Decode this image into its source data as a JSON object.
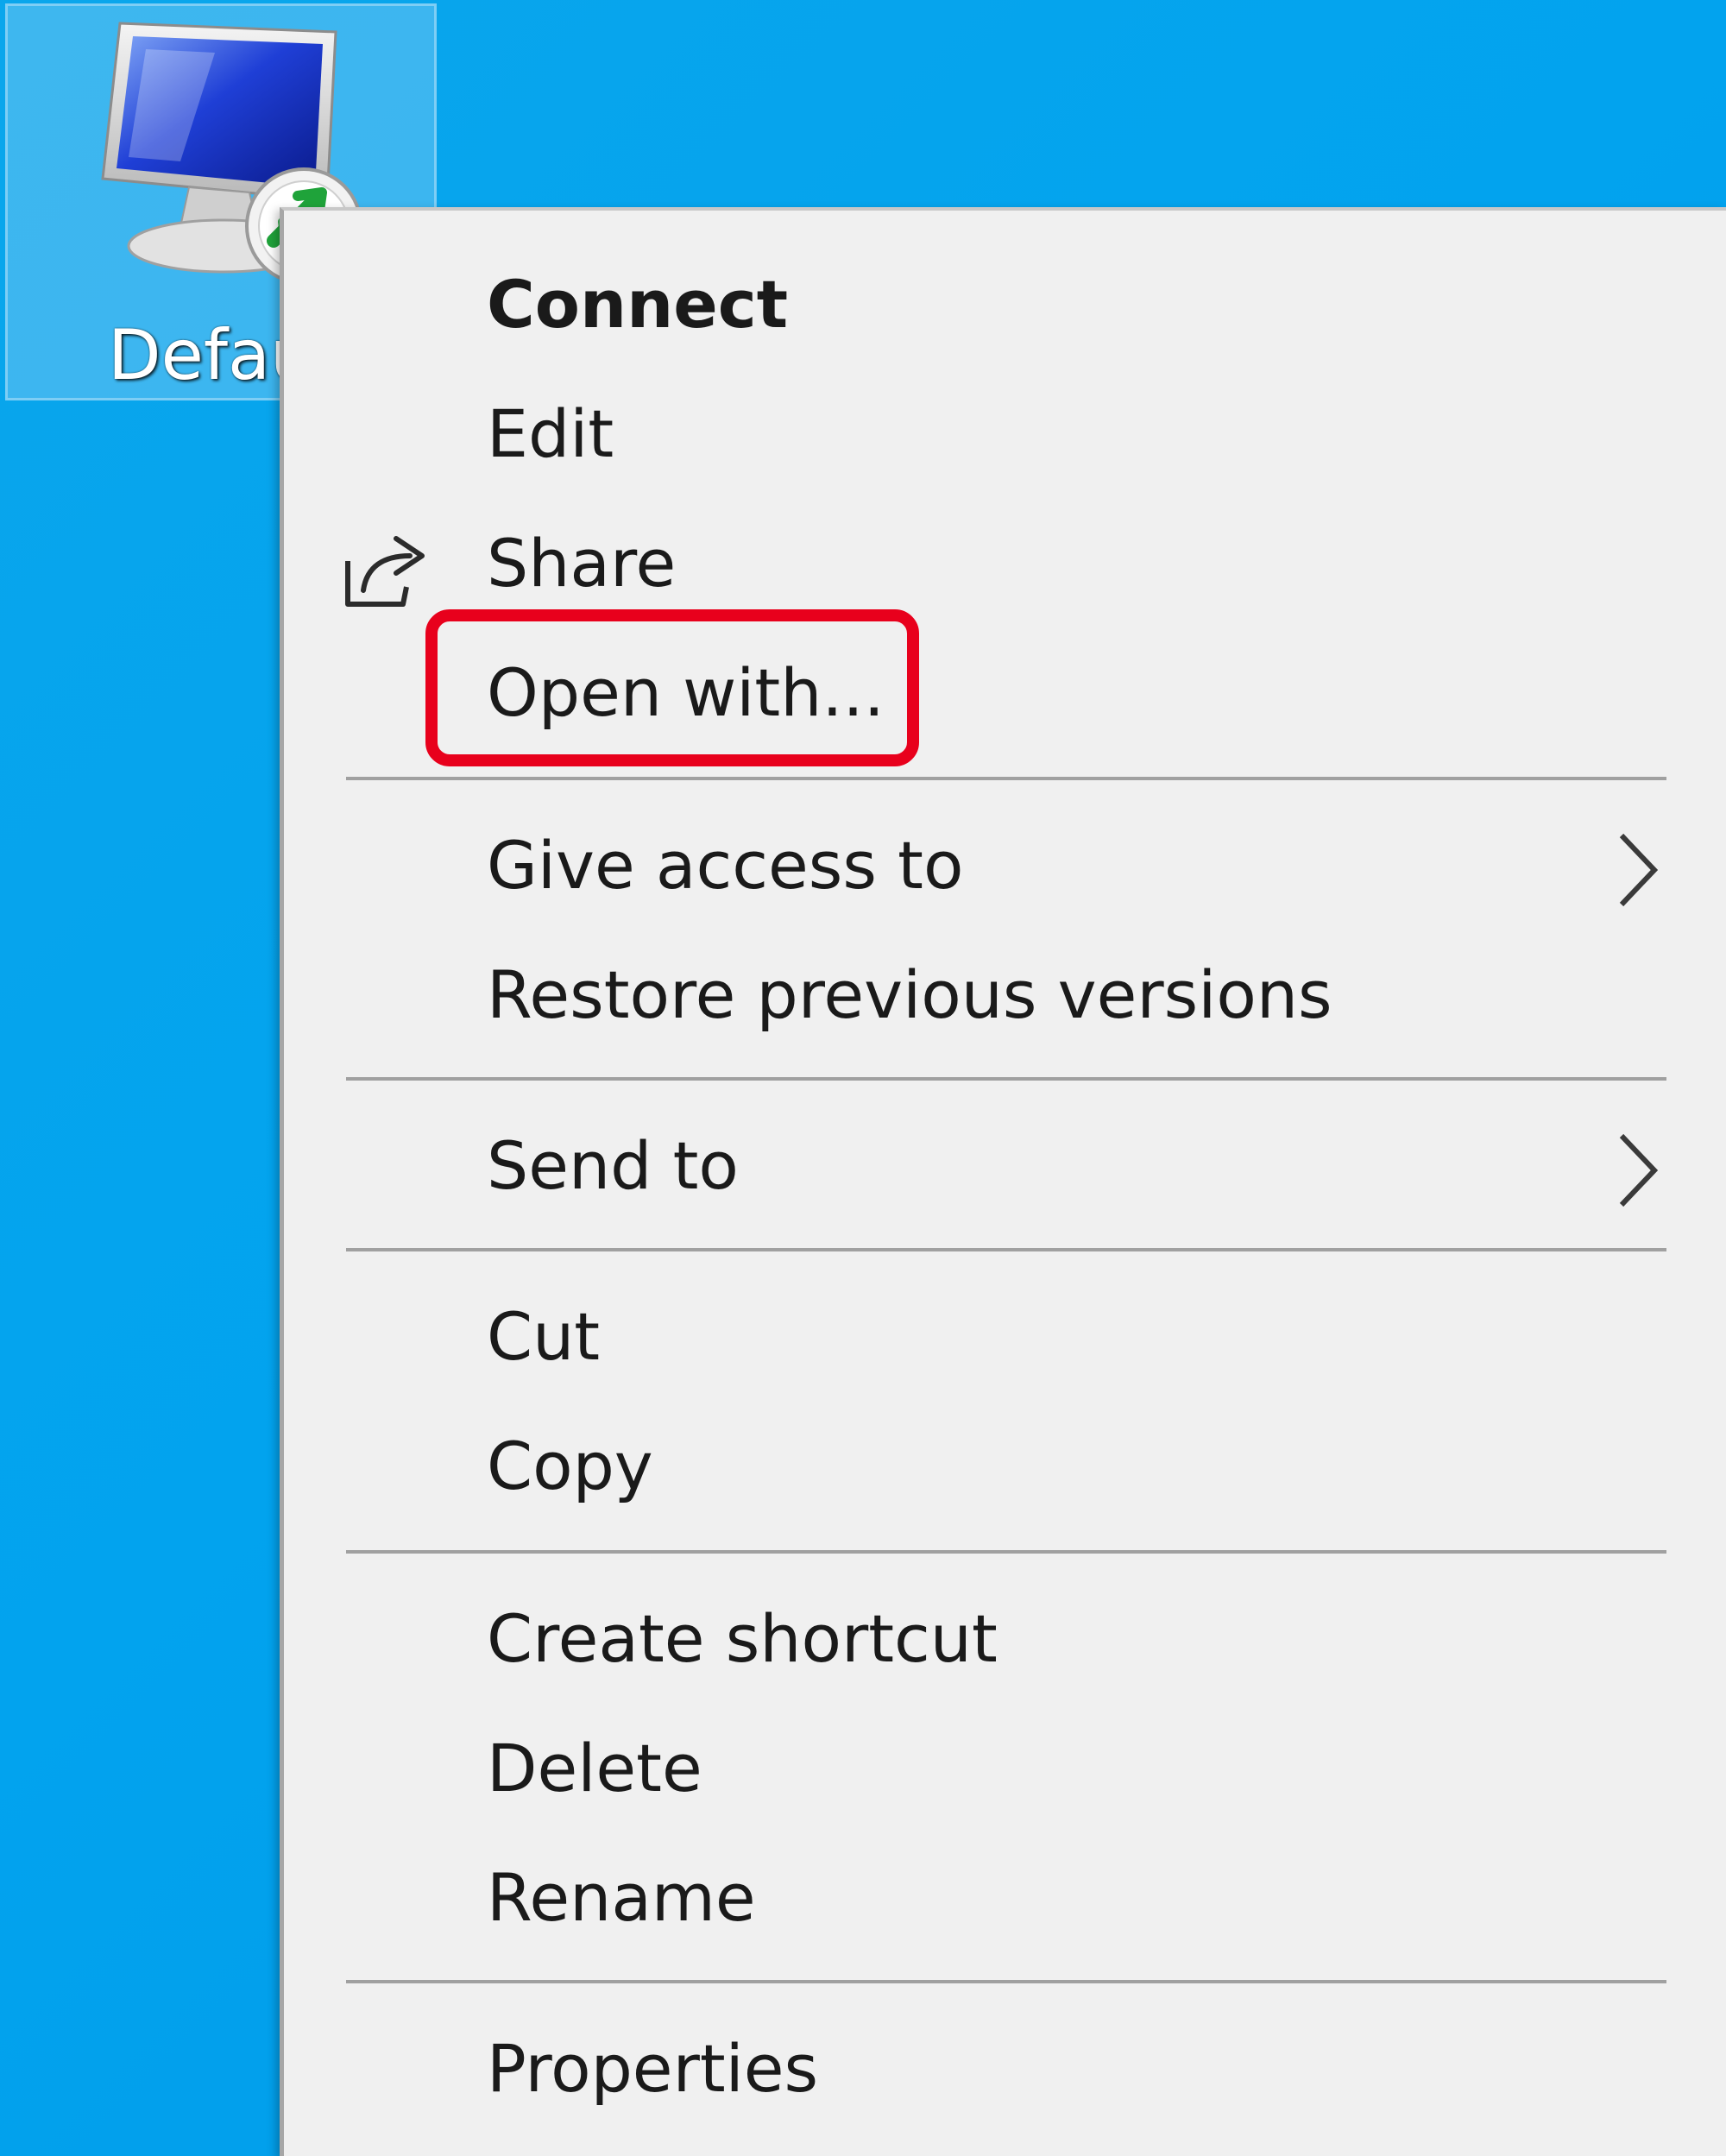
{
  "desktop_icon": {
    "label": "Defau",
    "icon_name": "remote-desktop-connection-icon"
  },
  "context_menu": {
    "items": [
      {
        "id": "connect",
        "label": "Connect",
        "bold": true
      },
      {
        "id": "edit",
        "label": "Edit"
      },
      {
        "id": "share",
        "label": "Share",
        "icon": "share-icon"
      },
      {
        "id": "open-with",
        "label": "Open with..."
      },
      {
        "id": "give-access-to",
        "label": "Give access to",
        "submenu": true
      },
      {
        "id": "restore-previous-versions",
        "label": "Restore previous versions"
      },
      {
        "id": "send-to",
        "label": "Send to",
        "submenu": true
      },
      {
        "id": "cut",
        "label": "Cut"
      },
      {
        "id": "copy",
        "label": "Copy"
      },
      {
        "id": "create-shortcut",
        "label": "Create shortcut"
      },
      {
        "id": "delete",
        "label": "Delete"
      },
      {
        "id": "rename",
        "label": "Rename"
      },
      {
        "id": "properties",
        "label": "Properties"
      }
    ]
  },
  "highlight": {
    "target": "open-with",
    "color": "#e8001c"
  },
  "colors": {
    "desktop_background": "#02a3ee",
    "menu_background": "#f0f0f0",
    "separator": "#a0a0a0"
  }
}
